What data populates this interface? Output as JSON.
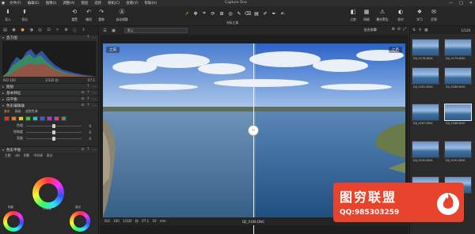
{
  "window": {
    "title": "Capture One",
    "app_logo": "capture-one-logo",
    "controls": [
      "—",
      "□",
      "✕"
    ]
  },
  "menu": [
    "文件(F)",
    "编辑(E)",
    "图像(I)",
    "调整(A)",
    "图层",
    "选择",
    "相机(C)",
    "查看(V)",
    "帮助(H)"
  ],
  "toolbar": {
    "left_buttons": [
      {
        "label": "导入",
        "icon": "import-icon"
      },
      {
        "label": "导出",
        "icon": "export-icon"
      },
      {
        "label": "重置",
        "icon": "reset-icon"
      },
      {
        "label": "撤消",
        "icon": "undo-icon"
      },
      {
        "label": "重做",
        "icon": "redo-icon"
      },
      {
        "label": "自动调整",
        "icon": "auto-adjust-icon"
      }
    ],
    "cursor_tools_label": "光标工具",
    "right_buttons": [
      {
        "label": "之前",
        "icon": "before-icon"
      },
      {
        "label": "网格",
        "icon": "grid-icon"
      },
      {
        "label": "曝光警告",
        "icon": "exposure-warning-icon"
      },
      {
        "label": "校对",
        "icon": "proof-icon"
      },
      {
        "label": "学习",
        "icon": "learn-icon"
      },
      {
        "label": "反馈",
        "icon": "feedback-icon"
      }
    ]
  },
  "left_panel": {
    "sections": {
      "histogram": "直方图",
      "layers": "图层",
      "base_char": "基本特征",
      "white_balance": "白平衡",
      "color_editor": "色彩编辑器",
      "color_balance": "色彩平衡"
    },
    "histogram_info": {
      "iso": "ISO 100",
      "shutter": "1/320 秒",
      "aperture": "f/7.1"
    },
    "color_editor_tabs": [
      "基本",
      "高级",
      "皮肤色调"
    ],
    "swatches": [
      "#e03030",
      "#e07a20",
      "#d8d020",
      "#40c040",
      "#30c0c0",
      "#3060e0",
      "#a040d0",
      "#d040a0"
    ],
    "sliders": [
      {
        "label": "色相",
        "value": "0",
        "pos": 0.5
      },
      {
        "label": "饱和度",
        "value": "0",
        "pos": 0.5
      },
      {
        "label": "亮度",
        "value": "0",
        "pos": 0.5
      }
    ],
    "balance_tabs": [
      "主题",
      "3向",
      "阴影",
      "中间调",
      "高光"
    ],
    "wheel_labels": {
      "mid": "中间调",
      "shadow": "阴影",
      "highlight": "高光"
    }
  },
  "viewer": {
    "preset": "默认",
    "fit": "适合屏幕",
    "before_label": "之前",
    "after_label": "之后",
    "split_handle": "‹›",
    "bottom_meta": "ISO 100  1/320 秒  f/7.1  10 mm",
    "filename": "DJI_0188.DNG"
  },
  "browser": {
    "count": "1/120",
    "thumbnails": [
      {
        "name": "DJI_0178.DNG"
      },
      {
        "name": "DJI_0179.DNG"
      },
      {
        "name": "DJI_0181.DNG"
      },
      {
        "name": "DJI_0186.DNG"
      },
      {
        "name": "DJI_0187.DNG"
      },
      {
        "name": "DJI_0188.DNG",
        "selected": true
      },
      {
        "name": "DJI_0190.DNG"
      },
      {
        "name": "DJI_0191.DNG"
      },
      {
        "name": ""
      },
      {
        "name": ""
      }
    ]
  },
  "watermark": {
    "main": "图穷联盟",
    "sub": "QQ:985303259"
  }
}
